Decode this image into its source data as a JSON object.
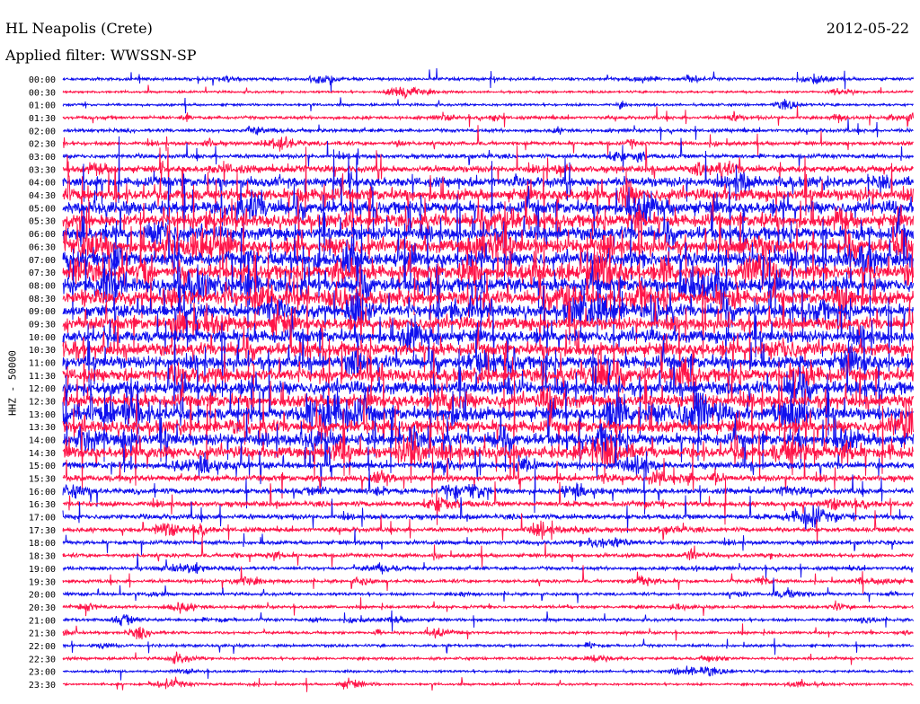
{
  "header": {
    "station": "HL Neapolis (Crete)",
    "filter": "Applied filter: WWSSN-SP",
    "date": "2012-05-22"
  },
  "colors": {
    "blue": "#1010ee",
    "red": "#ff1448",
    "text": "#000000",
    "background": "#ffffff"
  },
  "chart_data": {
    "type": "line",
    "title": "HL Neapolis (Crete)",
    "subtitle": "Applied filter: WWSSN-SP",
    "date": "2012-05-22",
    "ylabel": "HHZ - 50000",
    "xlabel": "",
    "grid": false,
    "legend": "none",
    "series_colors": [
      "#1010ee",
      "#ff1448"
    ],
    "rows": [
      "00:00",
      "00:30",
      "01:00",
      "01:30",
      "02:00",
      "02:30",
      "03:00",
      "03:30",
      "04:00",
      "04:30",
      "05:00",
      "05:30",
      "06:00",
      "06:30",
      "07:00",
      "07:30",
      "08:00",
      "08:30",
      "09:00",
      "09:30",
      "10:00",
      "10:30",
      "11:00",
      "11:30",
      "12:00",
      "12:30",
      "13:00",
      "13:30",
      "14:00",
      "14:30",
      "15:00",
      "15:30",
      "16:00",
      "16:30",
      "17:00",
      "17:30",
      "18:00",
      "18:30",
      "19:00",
      "19:30",
      "20:00",
      "20:30",
      "21:00",
      "21:30",
      "22:00",
      "22:30",
      "23:00",
      "23:30"
    ],
    "activity": [
      0.8,
      0.5,
      0.6,
      0.9,
      1.0,
      1.1,
      1.3,
      2.2,
      3.5,
      4.2,
      4.5,
      4.6,
      4.8,
      5.0,
      5.2,
      5.2,
      5.0,
      4.8,
      4.6,
      4.6,
      4.6,
      4.6,
      4.7,
      4.8,
      4.8,
      4.7,
      4.6,
      4.5,
      4.4,
      4.2,
      2.2,
      2.0,
      1.8,
      1.7,
      1.6,
      1.4,
      1.2,
      1.1,
      1.0,
      0.9,
      0.8,
      0.8,
      0.8,
      0.7,
      0.7,
      0.7,
      0.6,
      0.5
    ]
  }
}
